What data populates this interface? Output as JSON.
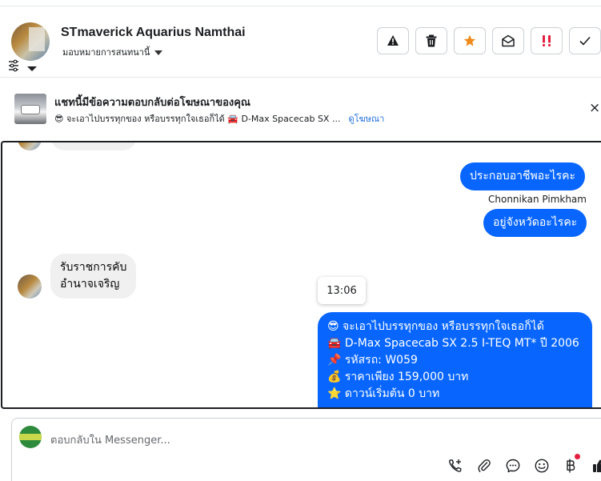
{
  "header": {
    "contact_name": "STmaverick Aquarius Namthai",
    "assign_label": "มอบหมายการสนทนานี้",
    "actions": {
      "spam": "Mark as spam",
      "delete": "Delete",
      "star": "Star",
      "unread": "Mark as unread",
      "follow_up": "Follow up",
      "done": "Mark as done"
    }
  },
  "ad_banner": {
    "title": "แชทนี้มีข้อความตอบกลับต่อโฆษณาของคุณ",
    "subtitle": "😎 จะเอาไปบรรทุกของ หรือบรรทุกใจเธอก็ได้ 🚘 D-Max Spacecab SX ...",
    "link": "ดูโฆษณา",
    "close": "×"
  },
  "messages": [
    {
      "dir": "out",
      "text": "ประกอบอาชีพอะไรคะ"
    },
    {
      "dir": "meta",
      "text": "Chonnikan Pimkham"
    },
    {
      "dir": "out",
      "text": "อยู่จังหวัดอะไรคะ"
    },
    {
      "dir": "in",
      "lines": [
        "รับราชการคับ",
        "อำนาจเจริญ"
      ]
    }
  ],
  "tooltip_time": "13:06",
  "ad_message": {
    "lines": [
      "😎 จะเอาไปบรรทุกของ หรือบรรทุกใจเธอก็ได้",
      "🚘 D-Max Spacecab SX 2.5 I-TEQ MT* ปี 2006",
      "📌 รหัสรถ: W059",
      "💰 ราคาเพียง 159,000 บาท",
      "⭐ ดาวน์เริ่มต้น 0 บาท"
    ]
  },
  "composer": {
    "placeholder": "ตอบกลับใน Messenger...",
    "tools": [
      "call-add-icon",
      "attachment-icon",
      "chat-bubble-icon",
      "emoji-icon",
      "baht-payment-icon",
      "like-icon"
    ]
  },
  "colors": {
    "accent": "#0866ff",
    "link": "#216fdb",
    "incoming_bubble": "#f0f0f0",
    "star": "#f08a1c",
    "follow_up": "#e41e3f"
  }
}
